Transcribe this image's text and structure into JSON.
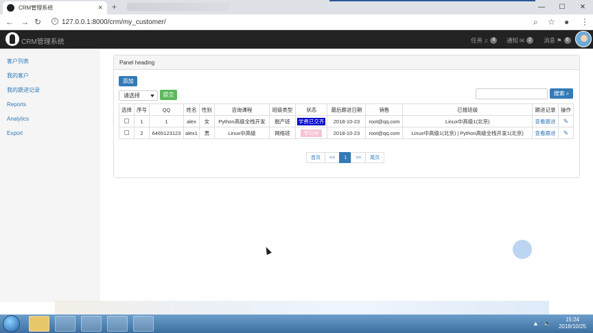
{
  "browser": {
    "tab_title": "CRM管理系统",
    "url": "127.0.0.1:8000/crm/my_customer/"
  },
  "navbar": {
    "brand": "CRM管理系统",
    "task_label": "任务",
    "task_count": "4",
    "notify_label": "通知",
    "notify_count": "2",
    "message_label": "消息",
    "message_count": "6"
  },
  "sidebar": {
    "items": [
      {
        "label": "客户列表"
      },
      {
        "label": "我的客户"
      },
      {
        "label": "我的跟进记录"
      },
      {
        "label": "Reports"
      },
      {
        "label": "Analytics"
      },
      {
        "label": "Export"
      }
    ]
  },
  "panel": {
    "heading": "Panel heading",
    "add_label": "添加",
    "select_value": "请选择",
    "submit_label": "提交",
    "search_placeholder": "",
    "search_label": "搜索"
  },
  "table": {
    "headers": [
      "选择",
      "序号",
      "QQ",
      "姓名",
      "性别",
      "咨询课程",
      "班级类型",
      "状态",
      "最后跟进日期",
      "销售",
      "已报班级",
      "跟进记录",
      "操作"
    ],
    "rows": [
      {
        "index": "1",
        "qq": "1",
        "name": "alex",
        "gender": "女",
        "course": "Python高级全栈开发",
        "class_type": "脱产班",
        "status": "学费已交齐",
        "date": "2018-10-23",
        "sales": "root@qq.com",
        "enrolled": "Linux中高级1(北京)",
        "follow": "查看跟进"
      },
      {
        "index": "2",
        "qq": "6465123123",
        "name": "alex1",
        "gender": "男",
        "course": "Linux中高级",
        "class_type": "网络班",
        "status": "学习中",
        "date": "2018-10-23",
        "sales": "root@qq.com",
        "enrolled": "Linux中高级1(北京) | Python高级全栈开发1(北京)",
        "follow": "查看跟进"
      }
    ]
  },
  "pagination": {
    "first": "首页",
    "prev": "<<",
    "current": "1",
    "next": ">>",
    "last": "尾页"
  },
  "taskbar": {
    "time": "15:24",
    "date": "2018/10/25"
  },
  "colors": {
    "navbar": "#222222",
    "primary": "#337ab7",
    "success": "#5cb85c",
    "status_paid": "#0000cd",
    "status_studying": "#f7c3d6"
  }
}
